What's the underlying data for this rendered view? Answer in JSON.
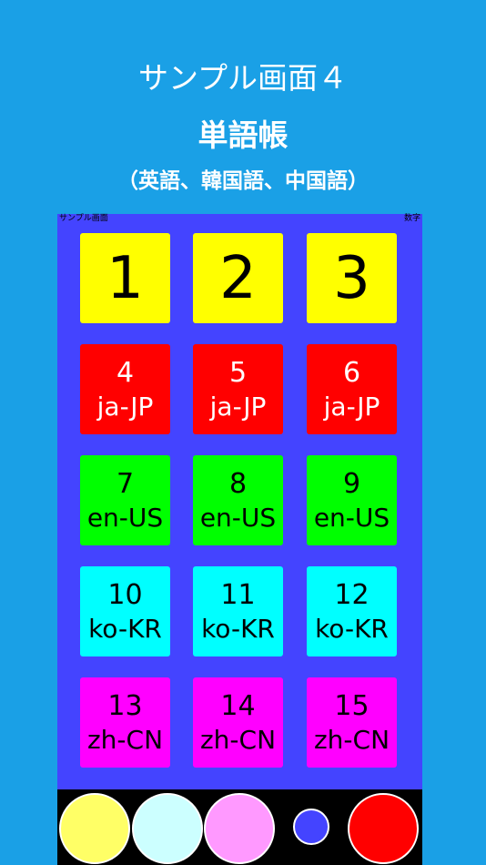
{
  "header": {
    "title": "サンプル画面４",
    "subtitle": "単語帳",
    "note": "（英語、韓国語、中国語）"
  },
  "panel": {
    "left_label": "サンプル画面",
    "right_label": "数字"
  },
  "tiles": [
    {
      "num": "1",
      "lang": "",
      "color": "#ffff00"
    },
    {
      "num": "2",
      "lang": "",
      "color": "#ffff00"
    },
    {
      "num": "3",
      "lang": "",
      "color": "#ffff00"
    },
    {
      "num": "4",
      "lang": "ja-JP",
      "color": "#ff0000"
    },
    {
      "num": "5",
      "lang": "ja-JP",
      "color": "#ff0000"
    },
    {
      "num": "6",
      "lang": "ja-JP",
      "color": "#ff0000"
    },
    {
      "num": "7",
      "lang": "en-US",
      "color": "#00ff00"
    },
    {
      "num": "8",
      "lang": "en-US",
      "color": "#00ff00"
    },
    {
      "num": "9",
      "lang": "en-US",
      "color": "#00ff00"
    },
    {
      "num": "10",
      "lang": "ko-KR",
      "color": "#00ffff"
    },
    {
      "num": "11",
      "lang": "ko-KR",
      "color": "#00ffff"
    },
    {
      "num": "12",
      "lang": "ko-KR",
      "color": "#00ffff"
    },
    {
      "num": "13",
      "lang": "zh-CN",
      "color": "#ff00ff"
    },
    {
      "num": "14",
      "lang": "zh-CN",
      "color": "#ff00ff"
    },
    {
      "num": "15",
      "lang": "zh-CN",
      "color": "#ff00ff"
    }
  ],
  "bottom_buttons": [
    {
      "name": "yellow-circle-button",
      "color": "#ffff66"
    },
    {
      "name": "lightcyan-circle-button",
      "color": "#ccffff"
    },
    {
      "name": "pink-circle-button",
      "color": "#ff99ff"
    },
    {
      "name": "small-blue-circle-button",
      "color": "#4444ff"
    },
    {
      "name": "red-circle-button",
      "color": "#ff0000"
    }
  ],
  "colors": {
    "background": "#1aa0e6",
    "panel": "#4444ff",
    "bottom_bar": "#000000"
  }
}
